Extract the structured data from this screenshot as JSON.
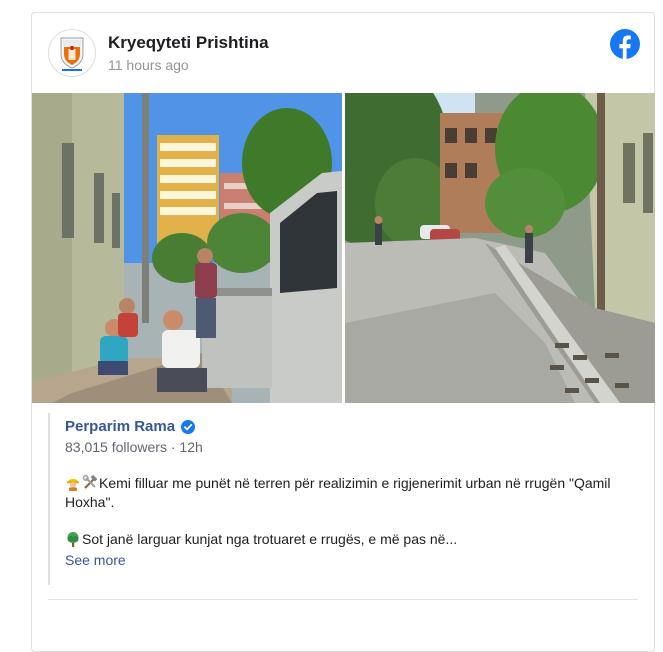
{
  "post": {
    "page_name": "Kryeqyteti Prishtina",
    "time": "11 hours ago",
    "avatar_text": "PRISHTINA"
  },
  "shared": {
    "author": "Perparim Rama",
    "followers": "83,015 followers",
    "separator": "·",
    "age": "12h",
    "para1": "Kemi filluar me punët në terren për realizimin e rigjenerimit urban në rrugën \"Qamil Hoxha\".",
    "para2": "Sot janë larguar kunjat nga trotuaret e rrugës, e më pas në...",
    "see_more": "See more"
  },
  "icons": {
    "platform": "facebook-icon",
    "verified": "verified-badge-icon",
    "emoji1": "construction-worker-emoji",
    "emoji2": "hammer-and-wrench-emoji",
    "emoji3": "tree-emoji"
  },
  "colors": {
    "facebook_blue": "#1877f2",
    "link_blue": "#365899",
    "border": "#dddfe2"
  }
}
